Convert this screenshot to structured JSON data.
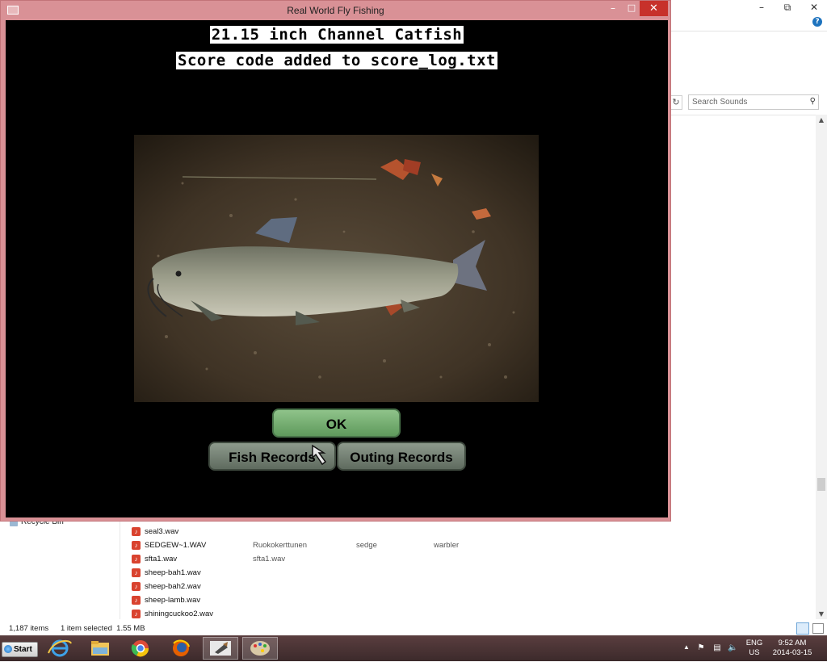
{
  "explorer": {
    "search": {
      "placeholder": "Search Sounds"
    },
    "nav_pane": {
      "recycle_bin": "Recycle Bin"
    },
    "files": [
      {
        "name": "seal3.wav",
        "c1": "",
        "c2": "",
        "c3": ""
      },
      {
        "name": "SEDGEW~1.WAV",
        "c1": "Ruokokerttunen",
        "c2": "sedge",
        "c3": "warbler"
      },
      {
        "name": "sfta1.wav",
        "c1": "sfta1.wav",
        "c2": "",
        "c3": ""
      },
      {
        "name": "sheep-bah1.wav",
        "c1": "",
        "c2": "",
        "c3": ""
      },
      {
        "name": "sheep-bah2.wav",
        "c1": "",
        "c2": "",
        "c3": ""
      },
      {
        "name": "sheep-lamb.wav",
        "c1": "",
        "c2": "",
        "c3": ""
      },
      {
        "name": "shiningcuckoo2.wav",
        "c1": "",
        "c2": "",
        "c3": ""
      }
    ],
    "status": {
      "items": "1,187 items",
      "selected": "1 item selected  1.55 MB"
    }
  },
  "game": {
    "title": "Real World Fly Fishing",
    "caption_line1": "21.15 inch Channel Catfish",
    "caption_line2": "Score code added to score_log.txt",
    "photo_subject": "channel catfish on gravel",
    "buttons": {
      "ok": "OK",
      "fish_records": "Fish Records",
      "outing_records": "Outing Records"
    },
    "colors": {
      "frame": "#d99196",
      "close": "#c7312b",
      "ok_button": "#6fae6b",
      "records_button": "#707c70"
    }
  },
  "taskbar": {
    "start_label": "Start",
    "apps": [
      "internet-explorer-icon",
      "file-explorer-icon",
      "chrome-icon",
      "firefox-icon",
      "fly-fishing-app-icon",
      "paint-icon"
    ],
    "tray": {
      "lang_line1": "ENG",
      "lang_line2": "US",
      "time": "9:52 AM",
      "date": "2014-03-15"
    }
  }
}
